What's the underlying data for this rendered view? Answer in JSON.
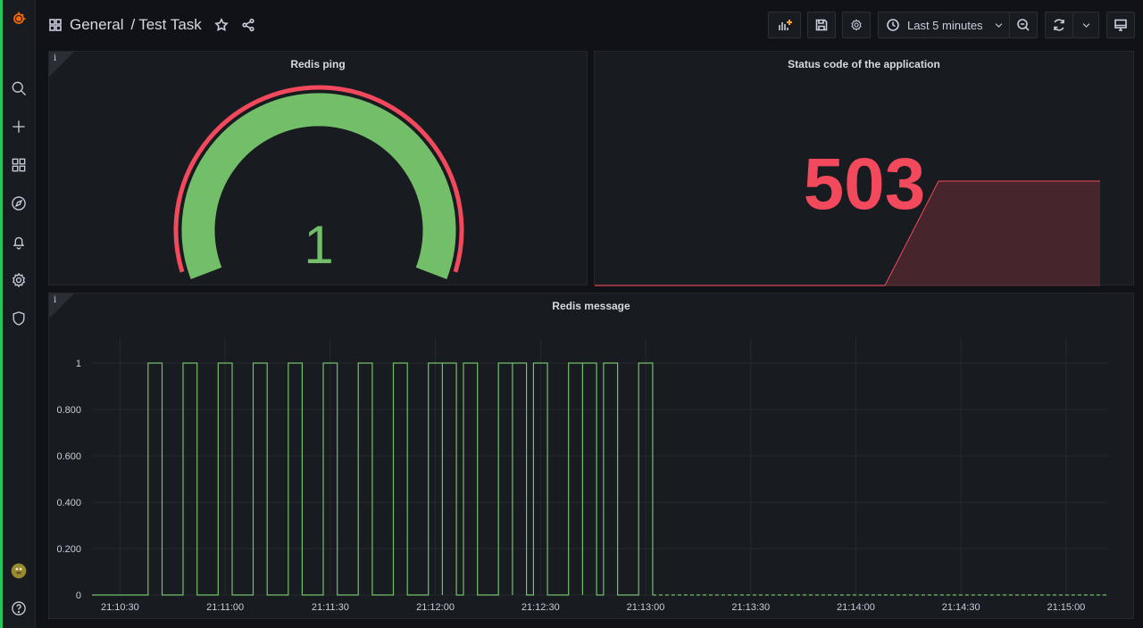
{
  "breadcrumb": {
    "folder": "General",
    "separator": "/",
    "dashboard": "Test Task"
  },
  "toolbar": {
    "time_range": "Last 5 minutes"
  },
  "colors": {
    "accent_green": "#73bf69",
    "accent_red": "#f2495c",
    "background": "#111217",
    "panel": "#181b1f"
  },
  "panels": {
    "gauge": {
      "title": "Redis ping",
      "value": "1",
      "info": "i"
    },
    "stat": {
      "title": "Status code of the application",
      "value": "503"
    },
    "timeseries": {
      "title": "Redis message",
      "info": "i"
    }
  },
  "chart_data": [
    {
      "type": "gauge",
      "title": "Redis ping",
      "value": 1
    },
    {
      "type": "area",
      "title": "Status code of the application",
      "value": 503
    },
    {
      "type": "line",
      "title": "Redis message",
      "y_ticks": [
        "1",
        "0.800",
        "0.600",
        "0.400",
        "0.200",
        "0"
      ],
      "ylim": [
        0,
        1
      ],
      "x_ticks": [
        "21:10:30",
        "21:11:00",
        "21:11:30",
        "21:12:00",
        "21:12:30",
        "21:13:00",
        "21:13:30",
        "21:14:00",
        "21:14:30",
        "21:15:00"
      ],
      "pulses_start": [
        "21:10:38",
        "21:10:48",
        "21:10:58",
        "21:11:08",
        "21:11:18",
        "21:11:28",
        "21:11:38",
        "21:11:48",
        "21:11:58",
        "21:12:02",
        "21:12:08",
        "21:12:18",
        "21:12:22",
        "21:12:28",
        "21:12:38",
        "21:12:42",
        "21:12:48",
        "21:12:58"
      ],
      "pulse_width_s": 4,
      "xlim": [
        "21:10:22",
        "21:15:12"
      ]
    }
  ]
}
